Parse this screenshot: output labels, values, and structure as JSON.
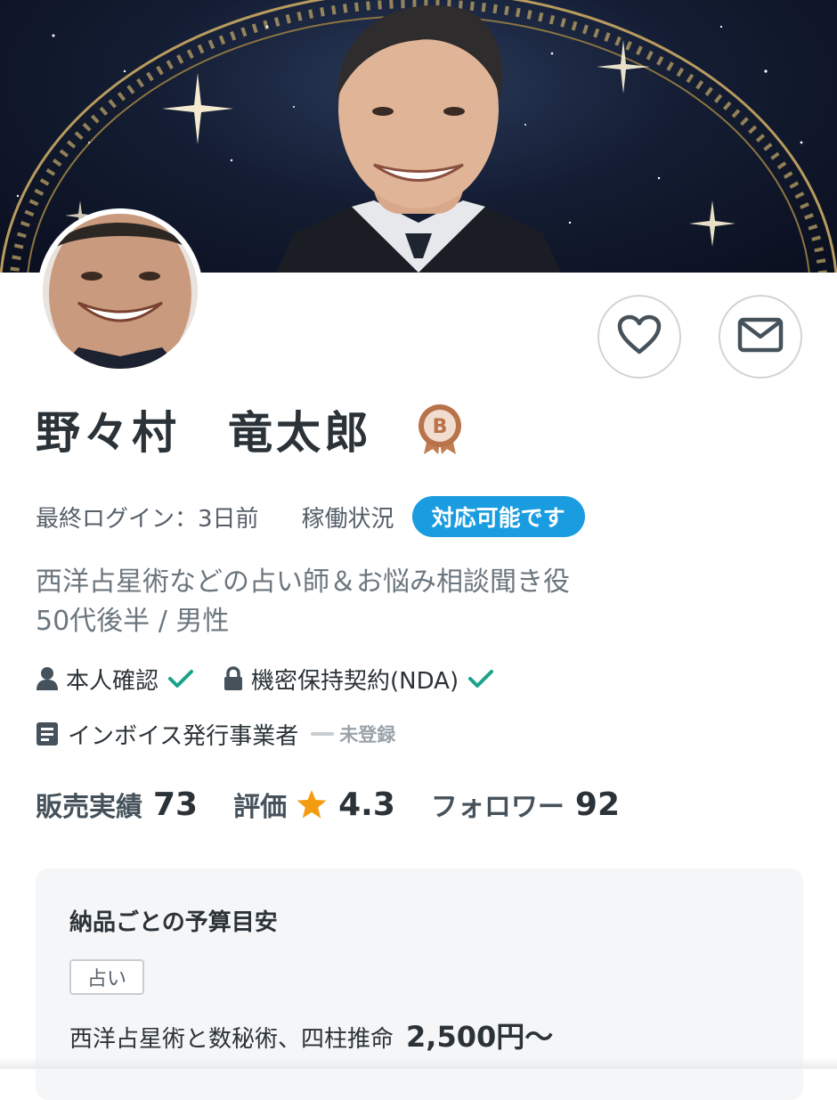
{
  "profile": {
    "name": "野々村　竜太郎",
    "rank_badge": "B",
    "last_login_label": "最終ログイン：3日前",
    "work_status_label": "稼働状況",
    "availability": "対応可能です",
    "bio_line1": "西洋占星術などの占い師＆お悩み相談聞き役",
    "bio_line2": "50代後半 / 男性"
  },
  "verifications": {
    "identity_label": "本人確認",
    "nda_label": "機密保持契約(NDA)",
    "invoice_label": "インボイス発行事業者",
    "invoice_status": "未登録"
  },
  "stats": {
    "sales_label": "販売実績",
    "sales_value": "73",
    "rating_label": "評価",
    "rating_value": "4.3",
    "followers_label": "フォロワー",
    "followers_value": "92"
  },
  "budget": {
    "title": "納品ごとの予算目安",
    "category_tag": "占い",
    "service_name": "西洋占星術と数秘術、四柱推命",
    "service_price": "2,500円〜"
  },
  "icons": {
    "favorite": "heart-icon",
    "message": "envelope-icon",
    "identity": "person-icon",
    "nda": "lock-icon",
    "invoice": "document-icon",
    "verified": "checkmark-icon",
    "rating": "star-icon"
  },
  "colors": {
    "accent_blue": "#1a9ce0",
    "check_green": "#1aa38a",
    "star_orange": "#f39c12",
    "rank_bronze": "#b8734a"
  }
}
